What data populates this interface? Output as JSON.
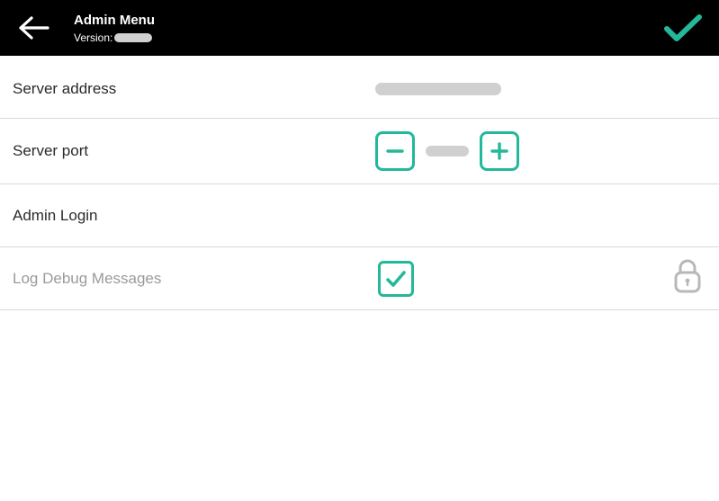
{
  "header": {
    "title": "Admin Menu",
    "version_label": "Version:"
  },
  "rows": {
    "server_address_label": "Server address",
    "server_port_label": "Server port",
    "admin_login_label": "Admin Login",
    "log_debug_label": "Log Debug Messages",
    "log_debug_checked": true
  },
  "accent": "#24b89a"
}
